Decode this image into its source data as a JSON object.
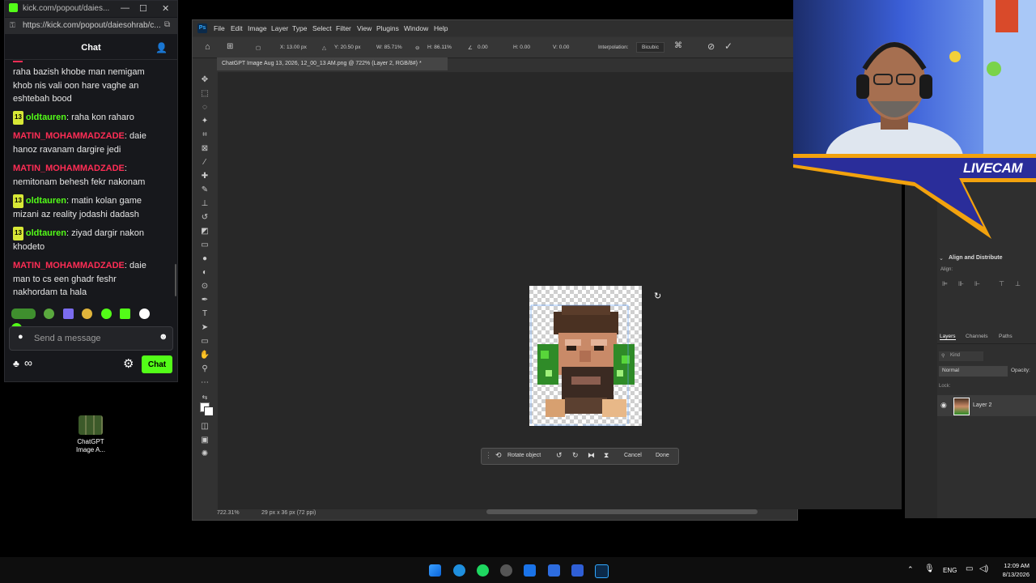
{
  "chat_window": {
    "titlebar_text": "kick.com/popout/daies...",
    "url": "https://kick.com/popout/daiesohrab/c...",
    "header_title": "Chat",
    "messages": [
      {
        "badge": "",
        "user": "",
        "text": "raha bazish khobe man nemigam khob nis vali oon hare vaghe an eshtebah bood"
      },
      {
        "badge": "13",
        "user": "oldtauren",
        "text": "raha kon raharo"
      },
      {
        "badge": "",
        "user": "MATIN_MOHAMMADZADE",
        "text": "daie hanoz ravanam dargire jedi"
      },
      {
        "badge": "",
        "user": "MATIN_MOHAMMADZADE",
        "text": "nemitonam behesh fekr nakonam"
      },
      {
        "badge": "13",
        "user": "oldtauren",
        "text": "matin kolan game mizani az reality jodashi dadash"
      },
      {
        "badge": "13",
        "user": "oldtauren",
        "text": "ziyad dargir nakon khodeto"
      },
      {
        "badge": "",
        "user": "MATIN_MOHAMMADZADE",
        "text": "daie man to cs een ghadr feshr nakhordam ta hala"
      }
    ],
    "input_placeholder": "Send a message",
    "send_label": "Chat",
    "infinity_symbol": "∞"
  },
  "desktop_icon": {
    "label": "ChatGPT Image A..."
  },
  "photoshop": {
    "menu": [
      "File",
      "Edit",
      "Image",
      "Layer",
      "Type",
      "Select",
      "Filter",
      "View",
      "Plugins",
      "Window",
      "Help"
    ],
    "options": {
      "x": "X: 13.00 px",
      "y": "Y: 20.50 px",
      "w": "W: 85.71%",
      "h": "H: 86.11%",
      "angle": "0.00",
      "h_skew": "H: 0.00",
      "v_skew": "V: 0.00",
      "interpolation_label": "Interpolation:",
      "interpolation_value": "Bicubic"
    },
    "doc_tab": "ChatGPT Image Aug 13, 2026, 12_00_13 AM.png @ 722% (Layer 2, RGB/8#) *",
    "context_bar": {
      "rotate": "Rotate object",
      "cancel": "Cancel",
      "done": "Done"
    },
    "status_zoom": "722.31%",
    "status_size": "29 px x 36 px (72 ppi)",
    "panels": {
      "align_title": "Align and Distribute",
      "align_sub": "Align:",
      "tabs": [
        "Layers",
        "Channels",
        "Paths"
      ],
      "kind_placeholder": "Kind",
      "blend_mode": "Normal",
      "opacity_label": "Opacity:",
      "lock_label": "Lock:",
      "layer_name": "Layer 2"
    }
  },
  "livecam": {
    "label": "LIVECAM"
  },
  "taskbar": {
    "lang": "ENG",
    "time": "12:09 AM",
    "date": "8/13/2026"
  }
}
